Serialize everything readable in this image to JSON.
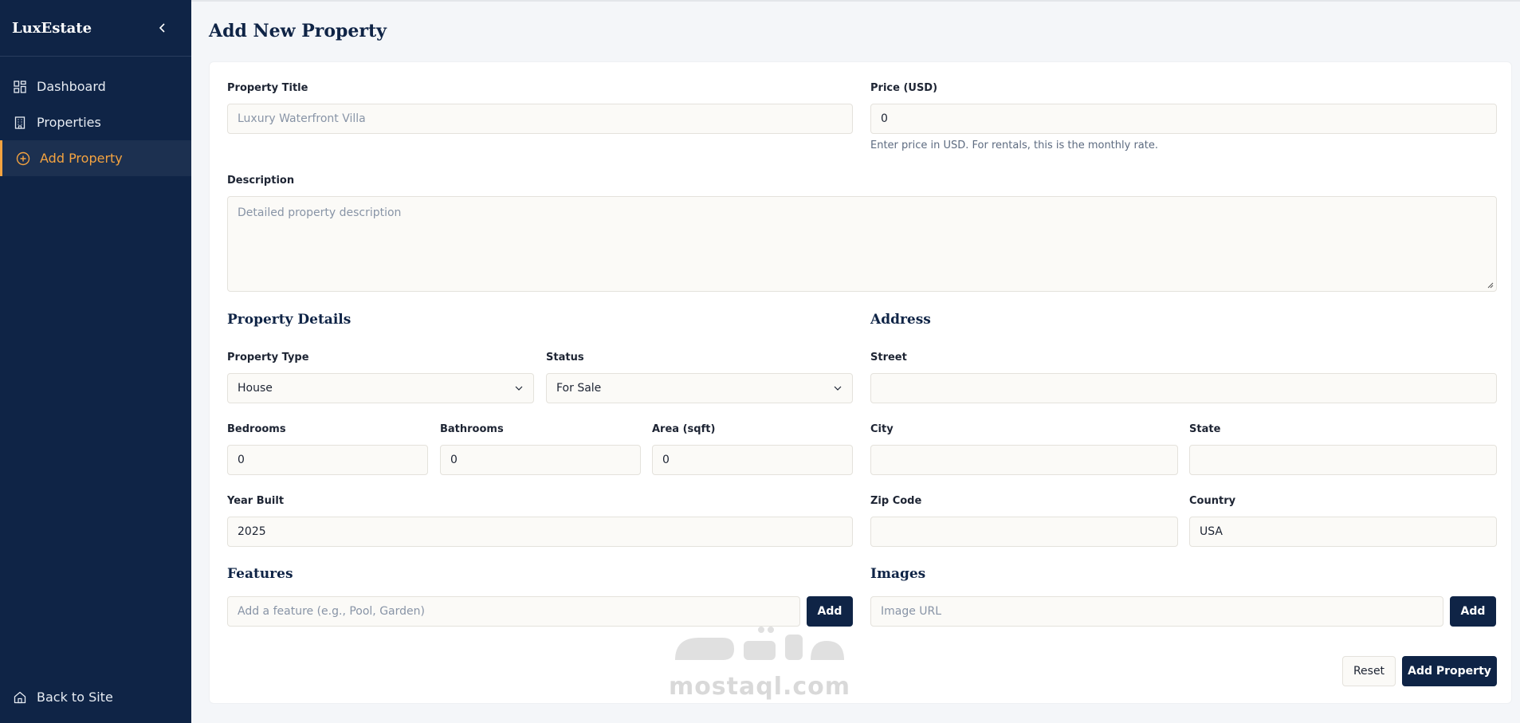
{
  "sidebar": {
    "brand": "LuxEstate",
    "items": [
      {
        "label": "Dashboard",
        "icon": "dashboard-icon"
      },
      {
        "label": "Properties",
        "icon": "building-icon"
      },
      {
        "label": "Add Property",
        "icon": "plus-circle-icon",
        "active": true
      }
    ],
    "back_label": "Back to Site"
  },
  "page": {
    "title": "Add New Property"
  },
  "form": {
    "title_label": "Property Title",
    "title_placeholder": "Luxury Waterfront Villa",
    "price_label": "Price (USD)",
    "price_value": "0",
    "price_help": "Enter price in USD. For rentals, this is the monthly rate.",
    "description_label": "Description",
    "description_placeholder": "Detailed property description",
    "details_heading": "Property Details",
    "type_label": "Property Type",
    "type_value": "House",
    "status_label": "Status",
    "status_value": "For Sale",
    "bedrooms_label": "Bedrooms",
    "bedrooms_value": "0",
    "bathrooms_label": "Bathrooms",
    "bathrooms_value": "0",
    "area_label": "Area (sqft)",
    "area_value": "0",
    "year_label": "Year Built",
    "year_value": "2025",
    "address_heading": "Address",
    "street_label": "Street",
    "street_value": "",
    "city_label": "City",
    "city_value": "",
    "state_label": "State",
    "state_value": "",
    "zip_label": "Zip Code",
    "zip_value": "",
    "country_label": "Country",
    "country_value": "USA",
    "features_heading": "Features",
    "feature_placeholder": "Add a feature (e.g., Pool, Garden)",
    "feature_add": "Add",
    "images_heading": "Images",
    "image_placeholder": "Image URL",
    "image_add": "Add",
    "reset_label": "Reset",
    "submit_label": "Add Property"
  },
  "watermark": {
    "text": "mostaql.com"
  },
  "colors": {
    "navy": "#0f2446",
    "accent": "#f4a340",
    "field_bg": "#fbfaf7"
  }
}
